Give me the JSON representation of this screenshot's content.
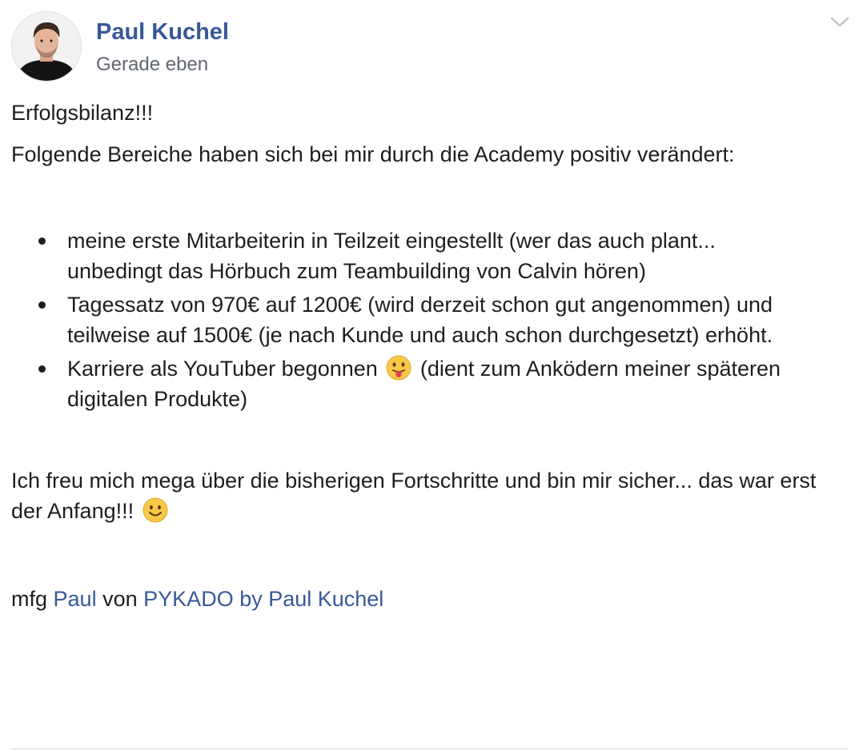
{
  "post": {
    "author_name": "Paul Kuchel",
    "timestamp": "Gerade eben",
    "avatar_icon": "profile-photo-icon",
    "menu_icon": "chevron-down-icon",
    "heading": "Erfolgsbilanz!!!",
    "intro": "Folgende Bereiche haben sich bei mir durch die Academy positiv verändert:",
    "bullets": [
      "meine erste Mitarbeiterin in Teilzeit eingestellt (wer das auch plant... unbedingt das Hörbuch zum Teambuilding von Calvin hören)",
      "Tagessatz von 970€ auf 1200€ (wird derzeit schon gut angenommen) und teilweise auf 1500€ (je nach Kunde und auch schon durchgesetzt) erhöht.",
      {
        "before": "Karriere als YouTuber begonnen",
        "emoji": "tongue-out-emoji",
        "after": "(dient zum Anködern meiner späteren digitalen Produkte)"
      }
    ],
    "closing": {
      "text": "Ich freu mich mega über die bisherigen Fortschritte und bin mir sicher... das war erst der Anfang!!!",
      "emoji": "smiley-emoji"
    },
    "signature": {
      "prefix": "mfg",
      "name_link": "Paul",
      "middle": "von",
      "company_link": "PYKADO by Paul Kuchel"
    }
  },
  "colors": {
    "link": "#385898",
    "text": "#1c1e21",
    "meta": "#616770",
    "divider": "#dadde1"
  }
}
